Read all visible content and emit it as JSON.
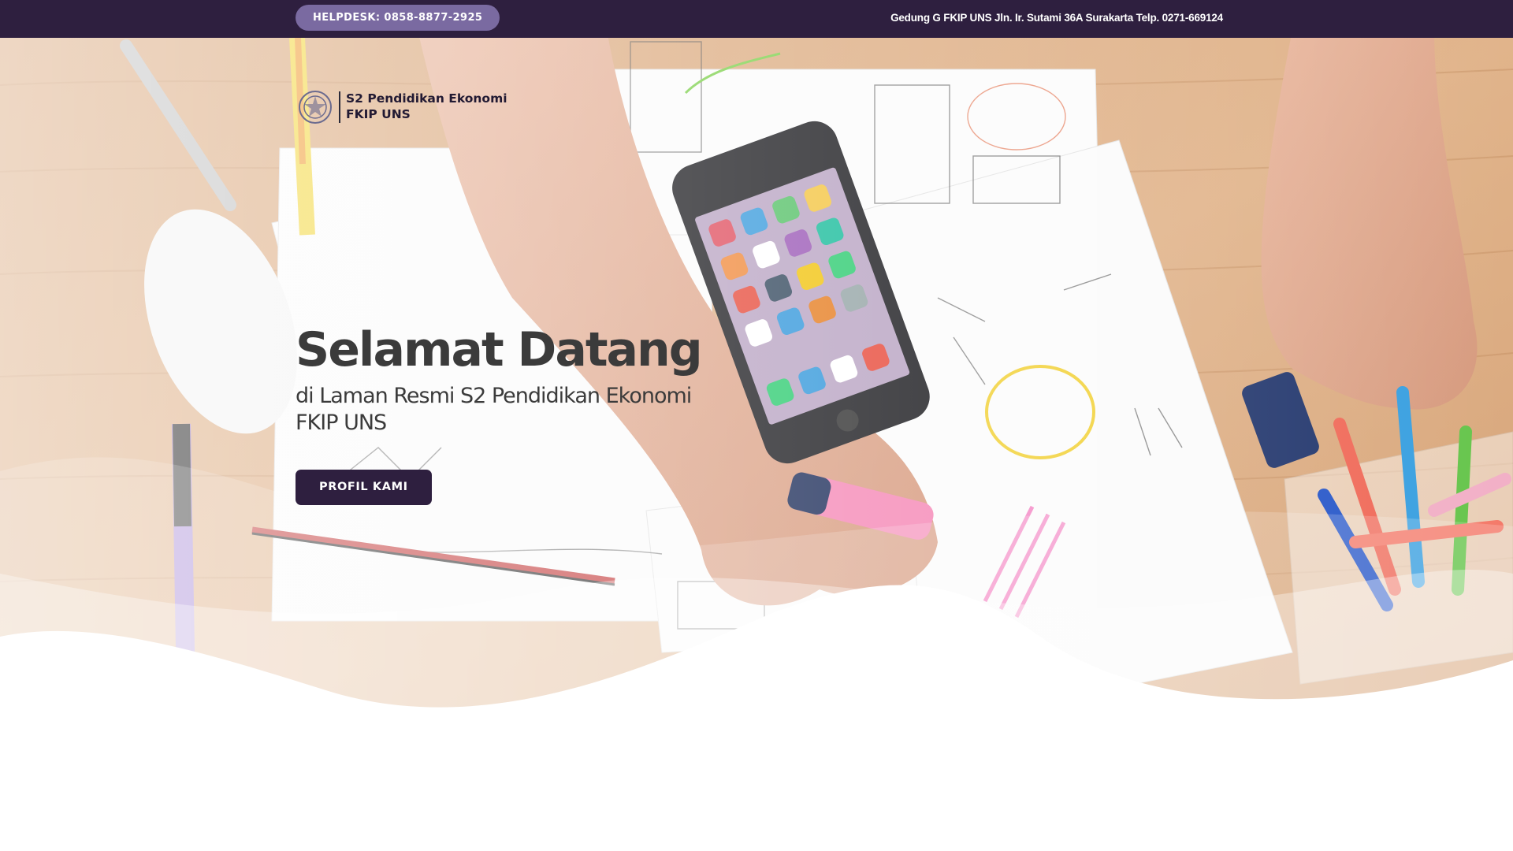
{
  "topbar": {
    "helpdesk_label": "HELPDESK: 0858-8877-2925",
    "address": "Gedung G FKIP UNS Jln. Ir. Sutami 36A Surakarta Telp. 0271-669124"
  },
  "logo": {
    "line1": "S2 Pendidikan Ekonomi",
    "line2": "FKIP UNS",
    "icon": "university-seal-icon"
  },
  "hero": {
    "title": "Selamat Datang",
    "subtitle": "di Laman Resmi S2 Pendidikan Ekonomi FKIP UNS",
    "cta_label": "PROFIL KAMI",
    "background_description_icon": "desk-workspace-image"
  },
  "colors": {
    "topbar": "#2e1f3f",
    "helpdesk_pill": "#7a6aa1",
    "cta": "#2e1f3f",
    "heading_text": "#3b3b3b"
  }
}
